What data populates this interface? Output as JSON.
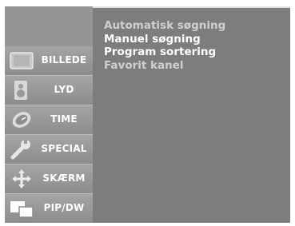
{
  "sidebar": {
    "items": [
      {
        "label": "BILLEDE",
        "icon": "picture-icon"
      },
      {
        "label": "LYD",
        "icon": "speaker-icon"
      },
      {
        "label": "TIME",
        "icon": "clock-icon"
      },
      {
        "label": "SPECIAL",
        "icon": "wrench-icon"
      },
      {
        "label": "SKÆRM",
        "icon": "move-arrows-icon"
      },
      {
        "label": "PIP/DW",
        "icon": "pip-icon"
      }
    ]
  },
  "menu": {
    "items": [
      {
        "label": "Automatisk søgning"
      },
      {
        "label": "Manuel søgning"
      },
      {
        "label": "Program sortering"
      },
      {
        "label": "Favorit kanel"
      }
    ]
  }
}
